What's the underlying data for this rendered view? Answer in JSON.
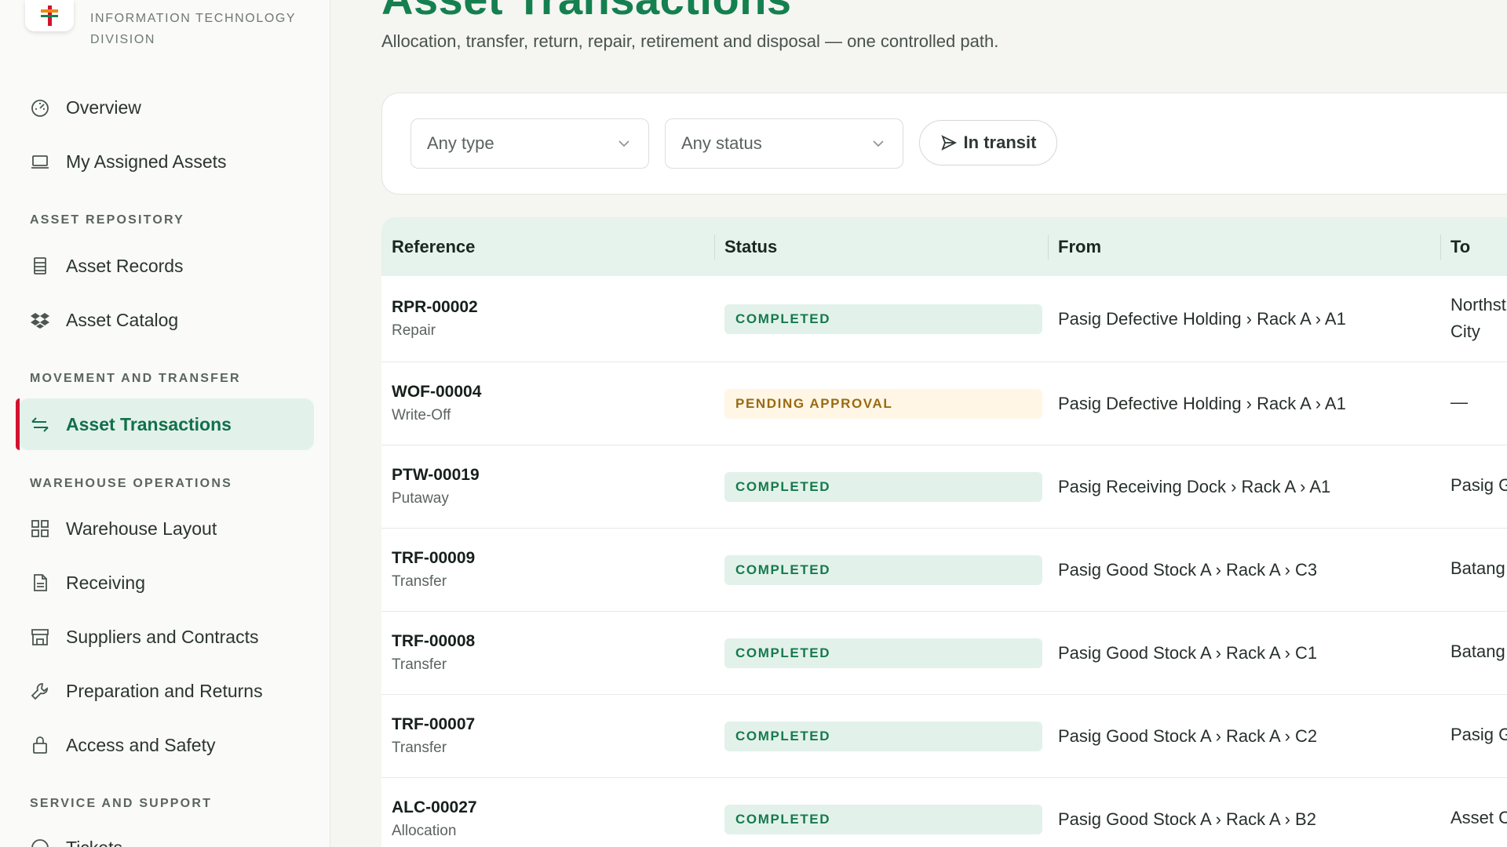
{
  "app": {
    "division_line1": "INFORMATION TECHNOLOGY",
    "division_line2": "DIVISION",
    "brand_color": "#14804f",
    "accent_red": "#d2122e"
  },
  "sidebar": {
    "items_top": [
      {
        "label": "Overview",
        "icon": "gauge-icon"
      },
      {
        "label": "My Assigned Assets",
        "icon": "laptop-icon"
      }
    ],
    "sections": [
      {
        "label": "ASSET REPOSITORY",
        "items": [
          {
            "label": "Asset Records",
            "icon": "records-icon"
          },
          {
            "label": "Asset Catalog",
            "icon": "dropbox-icon"
          }
        ]
      },
      {
        "label": "MOVEMENT AND TRANSFER",
        "items": [
          {
            "label": "Asset Transactions",
            "icon": "transfer-icon",
            "active": true
          }
        ]
      },
      {
        "label": "WAREHOUSE OPERATIONS",
        "items": [
          {
            "label": "Warehouse Layout",
            "icon": "grid-icon"
          },
          {
            "label": "Receiving",
            "icon": "document-icon"
          },
          {
            "label": "Suppliers and Contracts",
            "icon": "store-icon"
          },
          {
            "label": "Preparation and Returns",
            "icon": "wrench-icon"
          },
          {
            "label": "Access and Safety",
            "icon": "lock-icon"
          }
        ]
      },
      {
        "label": "SERVICE AND SUPPORT",
        "items": [
          {
            "label": "Tickets",
            "icon": "ticket-icon"
          }
        ]
      }
    ]
  },
  "header": {
    "title": "Asset Transactions",
    "subtitle": "Allocation, transfer, return, repair, retirement and disposal — one controlled path."
  },
  "filters": {
    "type_value": "Any type",
    "status_value": "Any status",
    "in_transit_label": "In transit"
  },
  "table": {
    "columns": [
      "Reference",
      "Status",
      "From",
      "To"
    ],
    "rows": [
      {
        "code": "RPR-00002",
        "type": "Repair",
        "status": "COMPLETED",
        "status_kind": "completed",
        "from": "Pasig Defective Holding › Rack A › A1",
        "to_line1": "Northst",
        "to_line2": "City"
      },
      {
        "code": "WOF-00004",
        "type": "Write-Off",
        "status": "PENDING APPROVAL",
        "status_kind": "pending",
        "from": "Pasig Defective Holding › Rack A › A1",
        "to_line1": "—",
        "to_line2": ""
      },
      {
        "code": "PTW-00019",
        "type": "Putaway",
        "status": "COMPLETED",
        "status_kind": "completed",
        "from": "Pasig Receiving Dock › Rack A › A1",
        "to_line1": "Pasig G",
        "to_line2": ""
      },
      {
        "code": "TRF-00009",
        "type": "Transfer",
        "status": "COMPLETED",
        "status_kind": "completed",
        "from": "Pasig Good Stock A › Rack A › C3",
        "to_line1": "Batang",
        "to_line2": ""
      },
      {
        "code": "TRF-00008",
        "type": "Transfer",
        "status": "COMPLETED",
        "status_kind": "completed",
        "from": "Pasig Good Stock A › Rack A › C1",
        "to_line1": "Batang",
        "to_line2": ""
      },
      {
        "code": "TRF-00007",
        "type": "Transfer",
        "status": "COMPLETED",
        "status_kind": "completed",
        "from": "Pasig Good Stock A › Rack A › C2",
        "to_line1": "Pasig G",
        "to_line2": ""
      },
      {
        "code": "ALC-00027",
        "type": "Allocation",
        "status": "COMPLETED",
        "status_kind": "completed",
        "from": "Pasig Good Stock A › Rack A › B2",
        "to_line1": "Asset C",
        "to_line2": ""
      }
    ]
  }
}
